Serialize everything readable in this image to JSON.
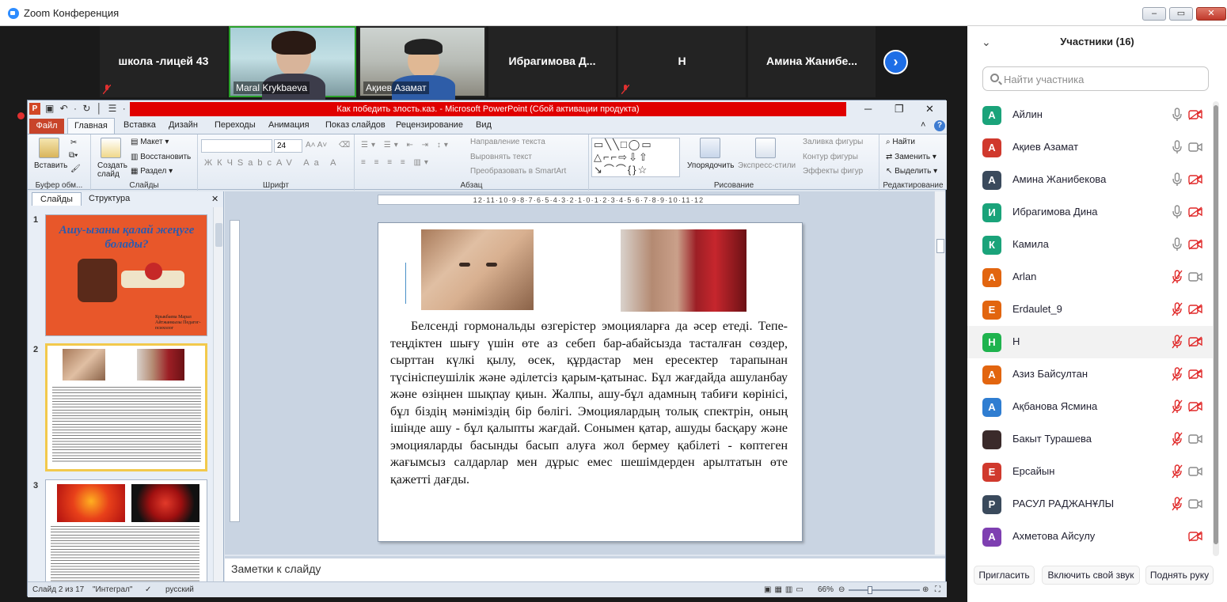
{
  "window": {
    "title": "Zoom Конференция"
  },
  "thumbnails": [
    {
      "name": "школа -лицей 43",
      "type": "name",
      "muted": true
    },
    {
      "name": "Maral Krykbaeva",
      "type": "video"
    },
    {
      "name": "Ақиев Азамат",
      "type": "video"
    },
    {
      "name": "Ибрагимова  Д...",
      "type": "name"
    },
    {
      "name": "Н",
      "type": "name",
      "muted": true
    },
    {
      "name": "Амина  Жанибе...",
      "type": "name"
    }
  ],
  "ppt": {
    "title": "Как победить злость.каз.  -  Microsoft PowerPoint (Сбой активации продукта)",
    "tabs": [
      "Файл",
      "Главная",
      "Вставка",
      "Дизайн",
      "Переходы",
      "Анимация",
      "Показ слайдов",
      "Рецензирование",
      "Вид"
    ],
    "active_tab": "Главная",
    "ribbon": {
      "paste": "Вставить",
      "clipboard_group": "Буфер обм...",
      "new_slide": "Создать слайд",
      "layout": "Макет",
      "reset": "Восстановить",
      "section": "Раздел",
      "slides_group": "Слайды",
      "font_size": "24",
      "font_group": "Шрифт",
      "text_direction": "Направление текста",
      "align_text": "Выровнять текст",
      "smartart": "Преобразовать в SmartArt",
      "paragraph_group": "Абзац",
      "arrange": "Упорядочить",
      "quick_styles": "Экспресс-стили",
      "shape_fill": "Заливка фигуры",
      "shape_outline": "Контур фигуры",
      "shape_effects": "Эффекты фигур",
      "drawing_group": "Рисование",
      "find": "Найти",
      "replace": "Заменить",
      "select": "Выделить",
      "editing_group": "Редактирование"
    },
    "pane_tabs": [
      "Слайды",
      "Структура"
    ],
    "thumbs": {
      "s1_title": "Ашу-ызаны қалай жеңуге болады?",
      "s1_author": "Крыкбаева Марал Айтжанкызы Педагог-психолог"
    },
    "ruler_text": "12·11·10·9·8·7·6·5·4·3·2·1·0·1·2·3·4·5·6·7·8·9·10·11·12",
    "slide_text": "Белсенді гормональды өзгерістер эмоцияларға да әсер етеді. Тепе-теңдіктен шығу үшін өте аз себеп бар-абайсызда тасталған сөздер, сырттан күлкі қылу, өсек, құрдастар мен ересектер тарапынан түсініспеушілік және әділетсіз қарым-қатынас. Бұл жағдайда ашуланбау және өзіңнен шықпау қиын. Жалпы, ашу-бұл адамның табиғи көрінісі, бұл біздің мәніміздің бір бөлігі. Эмоциялардың толық спектрін, оның ішінде ашу - бұл қалыпты жағдай. Сонымен қатар, ашуды басқару және эмоцияларды басынды басып алуға жол бермеу қабілеті - көптеген жағымсыз салдарлар мен дұрыс емес шешімдерден арылтатын өте қажетті дағды.",
    "notes_placeholder": "Заметки к слайду",
    "status": {
      "slide": "Слайд 2 из 17",
      "theme": "\"Интеграл\"",
      "lang": "русский",
      "zoom": "66%"
    }
  },
  "panel": {
    "title": "Участники (16)",
    "search_placeholder": "Найти участника",
    "participants": [
      {
        "initial": "А",
        "name": "Айлин",
        "color": "#1aa37a",
        "mic": "on",
        "cam": "off"
      },
      {
        "initial": "А",
        "name": "Ақиев Азамат",
        "color": "#d0392d",
        "mic": "on",
        "cam": "on"
      },
      {
        "initial": "А",
        "name": "Амина Жанибекова",
        "color": "#3a4a5c",
        "mic": "on",
        "cam": "off"
      },
      {
        "initial": "И",
        "name": "Ибрагимова Дина",
        "color": "#1aa37a",
        "mic": "on",
        "cam": "off"
      },
      {
        "initial": "К",
        "name": "Камила",
        "color": "#1aa37a",
        "mic": "on",
        "cam": "off"
      },
      {
        "initial": "A",
        "name": "Arlan",
        "color": "#e2650f",
        "mic": "muted",
        "cam": "on"
      },
      {
        "initial": "E",
        "name": "Erdaulet_9",
        "color": "#e2650f",
        "mic": "muted",
        "cam": "off"
      },
      {
        "initial": "Н",
        "name": "Н",
        "color": "#1fb34e",
        "mic": "muted",
        "cam": "off"
      },
      {
        "initial": "А",
        "name": "Азиз Байсултан",
        "color": "#e2650f",
        "mic": "muted",
        "cam": "off"
      },
      {
        "initial": "А",
        "name": "Ақбанова Ясмина",
        "color": "#2f7dd1",
        "mic": "muted",
        "cam": "off"
      },
      {
        "initial": "",
        "name": "Бакыт Турашева",
        "color": "#3a2a2a",
        "mic": "muted",
        "cam": "on"
      },
      {
        "initial": "Е",
        "name": "Ерсайын",
        "color": "#d0392d",
        "mic": "muted",
        "cam": "on"
      },
      {
        "initial": "Р",
        "name": "РАСУЛ РАДЖАНҰЛЫ",
        "color": "#3a4a5c",
        "mic": "muted",
        "cam": "on"
      },
      {
        "initial": "А",
        "name": "Ахметова Айсулу",
        "color": "#7e3fb1",
        "mic": "none",
        "cam": "off"
      }
    ],
    "footer": {
      "invite": "Пригласить",
      "unmute": "Включить свой звук",
      "raise": "Поднять руку"
    }
  }
}
